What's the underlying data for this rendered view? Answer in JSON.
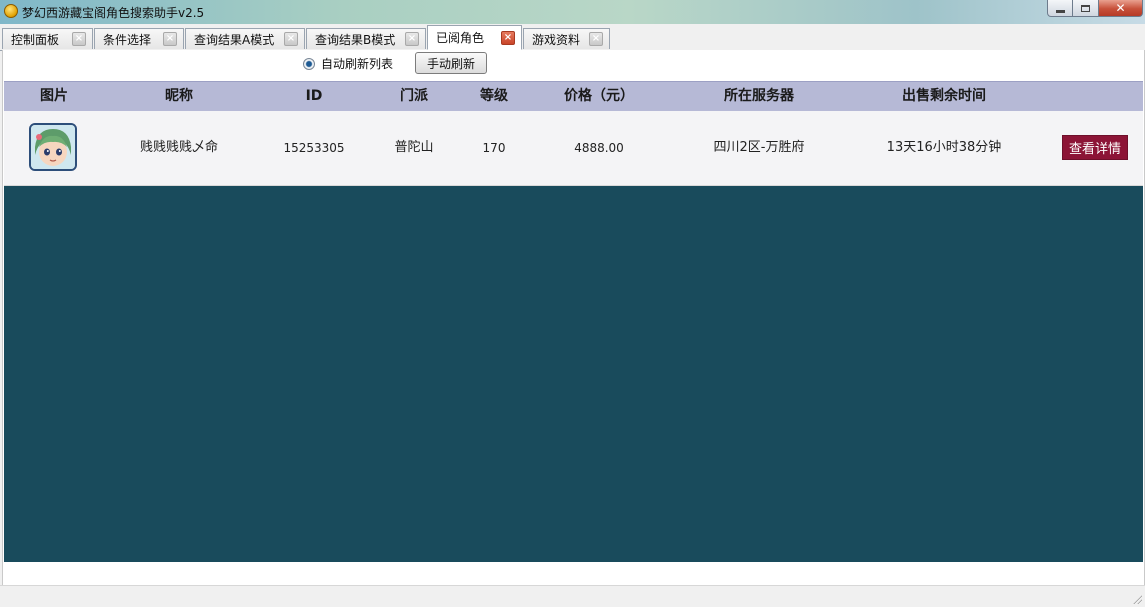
{
  "window": {
    "title": "梦幻西游藏宝阁角色搜索助手v2.5",
    "buttons": {
      "close": "✕"
    }
  },
  "tabs": [
    {
      "label": "控制面板",
      "active": false
    },
    {
      "label": "条件选择",
      "active": false
    },
    {
      "label": "查询结果A模式",
      "active": false
    },
    {
      "label": "查询结果B模式",
      "active": false
    },
    {
      "label": "已阅角色",
      "active": true
    },
    {
      "label": "游戏资料",
      "active": false
    }
  ],
  "toolbar": {
    "auto_refresh_label": "自动刷新列表",
    "manual_refresh_label": "手动刷新"
  },
  "table": {
    "columns": [
      "图片",
      "昵称",
      "ID",
      "门派",
      "等级",
      "价格（元）",
      "所在服务器",
      "出售剩余时间"
    ],
    "rows": [
      {
        "nickname": "贱贱贱贱乄命",
        "id": "15253305",
        "school": "普陀山",
        "level": "170",
        "price": "4888.00",
        "server": "四川2区-万胜府",
        "time_left": "13天16小时38分钟",
        "detail_label": "查看详情"
      }
    ]
  },
  "colors": {
    "header_bg": "#b6b9d6",
    "empty_area_bg": "#194b5c",
    "detail_button": "#8c1436"
  }
}
